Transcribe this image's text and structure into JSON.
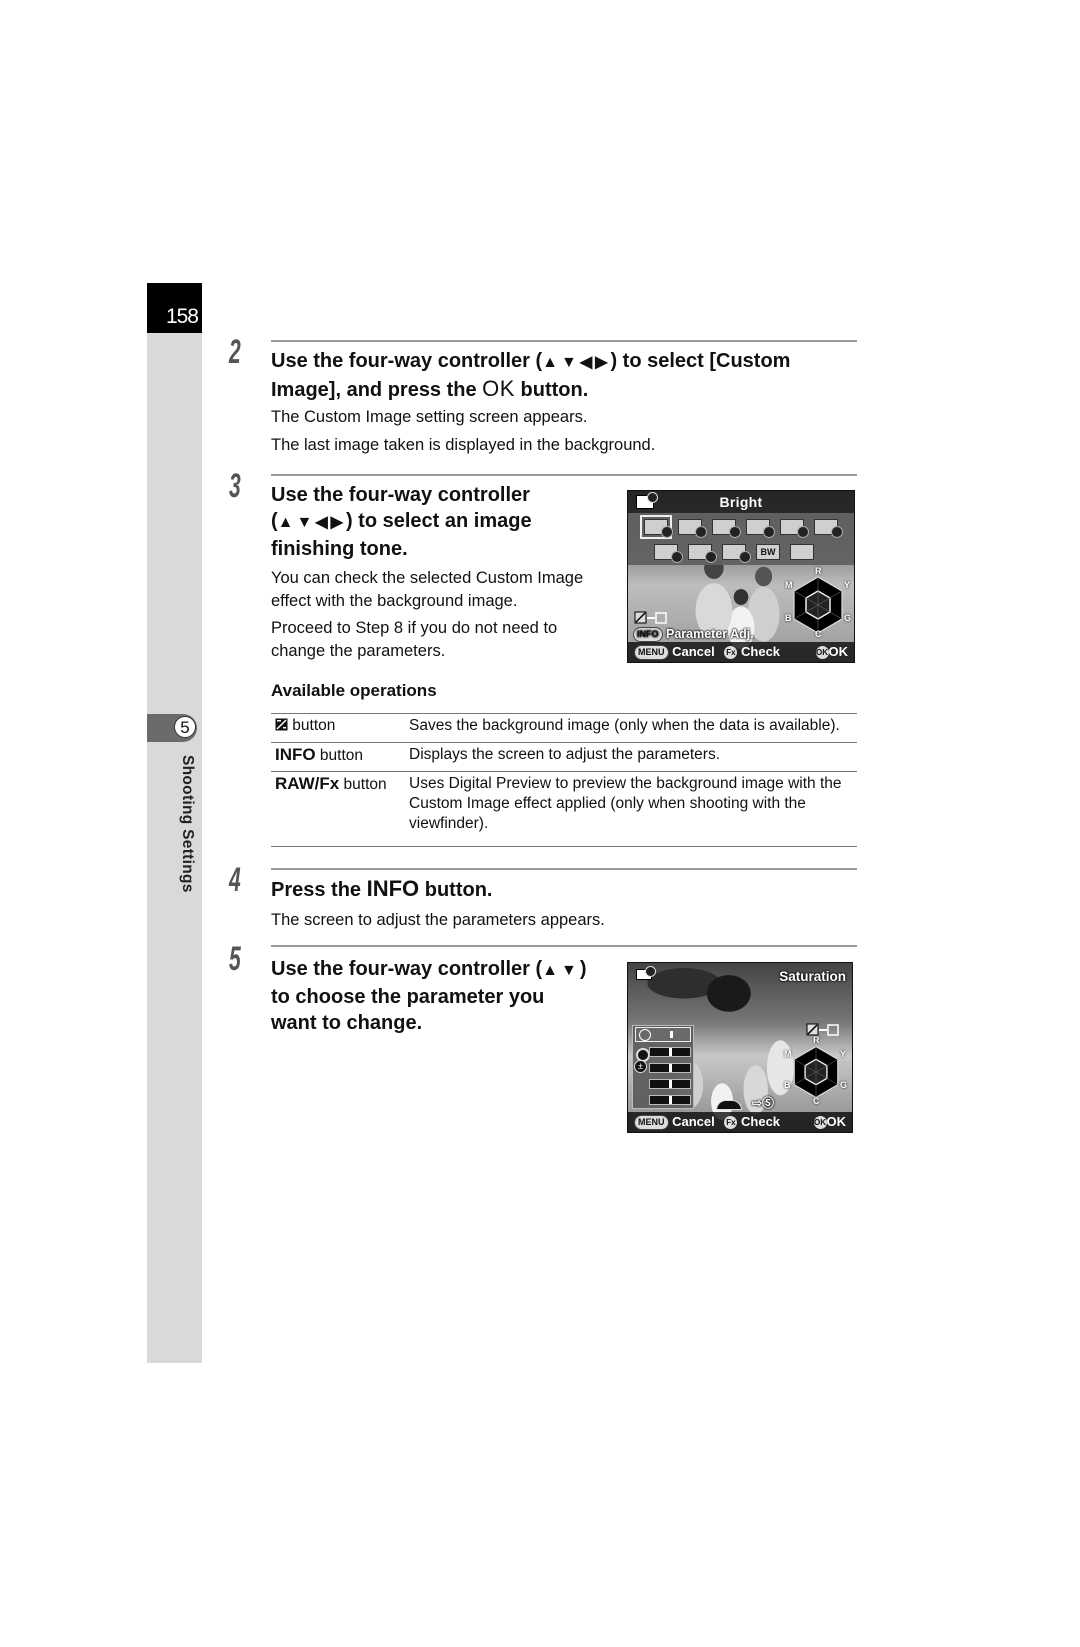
{
  "page": {
    "page_number": "158",
    "chapter_number": "5",
    "chapter_title": "Shooting Settings"
  },
  "arrows": {
    "four_way": "▲▼◀▶",
    "up_down": "▲▼"
  },
  "steps": [
    {
      "number": "2",
      "heading_pre": "Use the four-way controller (",
      "heading_mid": ") to select [Custom Image], and press the ",
      "heading_key": "OK",
      "heading_post": " button.",
      "body": [
        "The Custom Image setting screen appears.",
        "The last image taken is displayed in the background."
      ]
    },
    {
      "number": "3",
      "heading_line1": "Use the four-way controller",
      "heading_line2_post": ") to select an image",
      "heading_line3": "finishing tone.",
      "body": [
        "You can check the selected Custom Image effect with the background image.",
        "Proceed to Step 8 if you do not need to change the parameters."
      ]
    },
    {
      "number": "4",
      "heading_pre": "Press the ",
      "heading_key": "INFO",
      "heading_post": " button.",
      "body": [
        "The screen to adjust the parameters appears."
      ]
    },
    {
      "number": "5",
      "heading_line1_pre": "Use the four-way controller (",
      "heading_line1_post": ")",
      "heading_line2": "to choose the parameter you",
      "heading_line3": "want to change."
    }
  ],
  "operations": {
    "title": "Available operations",
    "rows": [
      {
        "key_icon": "save-image-icon",
        "key_bold": "",
        "key_text": " button",
        "description": "Saves the background image (only when the data is available)."
      },
      {
        "key_bold": "INFO",
        "key_text": " button",
        "description": "Displays the screen to adjust the parameters."
      },
      {
        "key_bold": "RAW/Fx",
        "key_text": " button",
        "description": "Uses Digital Preview to preview the background image with the Custom Image effect applied (only when shooting with the viewfinder)."
      }
    ]
  },
  "camera_screen_1": {
    "title": "Bright",
    "tones_row1": [
      "",
      "",
      "",
      "",
      "",
      ""
    ],
    "tones_row2": [
      "",
      "",
      "",
      "BW",
      ""
    ],
    "selected_tone_index": 0,
    "info_label": "Parameter Adj.",
    "info_key": "INFO",
    "hex_labels": [
      "R",
      "Y",
      "G",
      "C",
      "B",
      "M"
    ],
    "buttons": {
      "menu_key": "MENU",
      "cancel": "Cancel",
      "fx_key": "Fx",
      "check": "Check",
      "ok_key": "OK",
      "ok": "OK"
    }
  },
  "camera_screen_2": {
    "title": "Saturation",
    "hex_labels": [
      "R",
      "Y",
      "G",
      "C",
      "B",
      "M"
    ],
    "parameters": [
      {
        "name": "saturation",
        "value_fraction": 0.5
      },
      {
        "name": "hue",
        "value_fraction": 0.5
      },
      {
        "name": "high-low-key",
        "value_fraction": 0.5
      },
      {
        "name": "contrast",
        "value_fraction": 0.5
      },
      {
        "name": "sharpness",
        "value_fraction": 0.5
      }
    ],
    "buttons": {
      "menu_key": "MENU",
      "cancel": "Cancel",
      "fx_key": "Fx",
      "check": "Check",
      "ok_key": "OK",
      "ok": "OK"
    }
  }
}
